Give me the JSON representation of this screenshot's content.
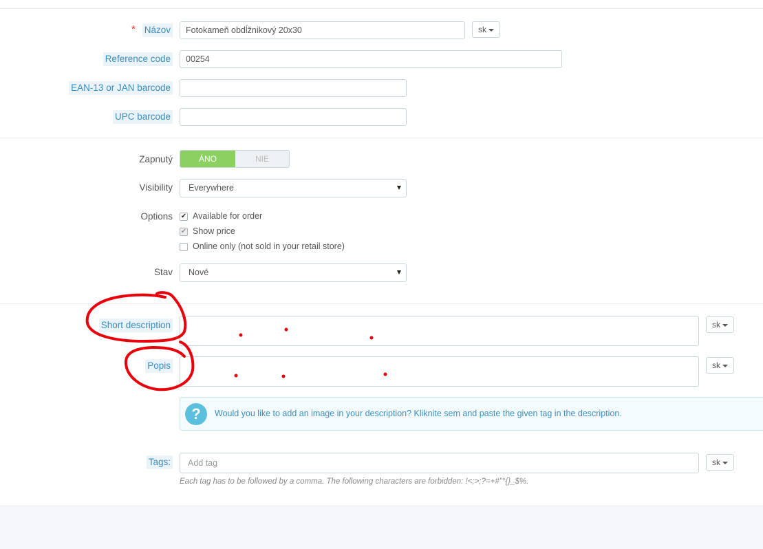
{
  "fields": {
    "name": {
      "label": "Názov",
      "value": "Fotokameň obdĺžnikový 20x30",
      "lang": "sk"
    },
    "reference": {
      "label": "Reference code",
      "value": "00254"
    },
    "ean13": {
      "label": "EAN-13 or JAN barcode",
      "value": ""
    },
    "upc": {
      "label": "UPC barcode",
      "value": ""
    }
  },
  "enabled": {
    "label": "Zapnutý",
    "on_label": "ÁNO",
    "off_label": "NIE",
    "value": true
  },
  "visibility": {
    "label": "Visibility",
    "value": "Everywhere"
  },
  "options": {
    "label": "Options",
    "items": [
      {
        "label": "Available for order",
        "checked": true,
        "disabled": false
      },
      {
        "label": "Show price",
        "checked": true,
        "disabled": true
      },
      {
        "label": "Online only (not sold in your retail store)",
        "checked": false,
        "disabled": false
      }
    ]
  },
  "condition": {
    "label": "Stav",
    "value": "Nové"
  },
  "short_description": {
    "label": "Short description",
    "lang": "sk"
  },
  "description": {
    "label": "Popis",
    "lang": "sk"
  },
  "image_hint": {
    "icon": "question-icon",
    "text": "Would you like to add an image in your description? Kliknite sem and paste the given tag in the description."
  },
  "tags": {
    "label": "Tags:",
    "placeholder": "Add tag",
    "lang": "sk",
    "help": "Each tag has to be followed by a comma. The following characters are forbidden: !<;>;?=+#\"°{}_$%."
  },
  "annotation_color": "#e8000b"
}
